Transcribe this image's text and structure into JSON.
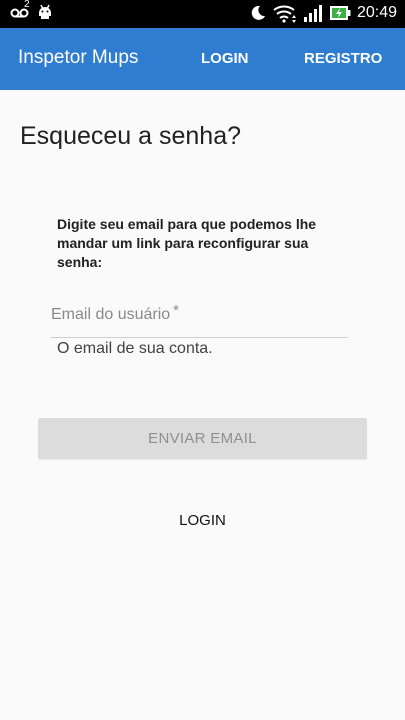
{
  "status_bar": {
    "time": "20:49",
    "voicemail_count": "2",
    "icons": [
      "voicemail-icon",
      "android-icon",
      "moon-icon",
      "wifi-icon",
      "signal-icon",
      "battery-charging-icon"
    ]
  },
  "app_bar": {
    "title": "Inspetor Mups",
    "nav": {
      "login": "LOGIN",
      "register": "REGISTRO"
    },
    "color": "#2f7dd1"
  },
  "form": {
    "title": "Esqueceu a senha?",
    "instructions": "Digite seu email para que podemos lhe mandar um link para reconfigurar sua senha:",
    "email_label": "Email do usuário",
    "required_mark": "*",
    "email_value": "",
    "helper_text": "O email de sua conta.",
    "submit_label": "ENVIAR EMAIL",
    "submit_enabled": false,
    "login_link": "LOGIN"
  }
}
